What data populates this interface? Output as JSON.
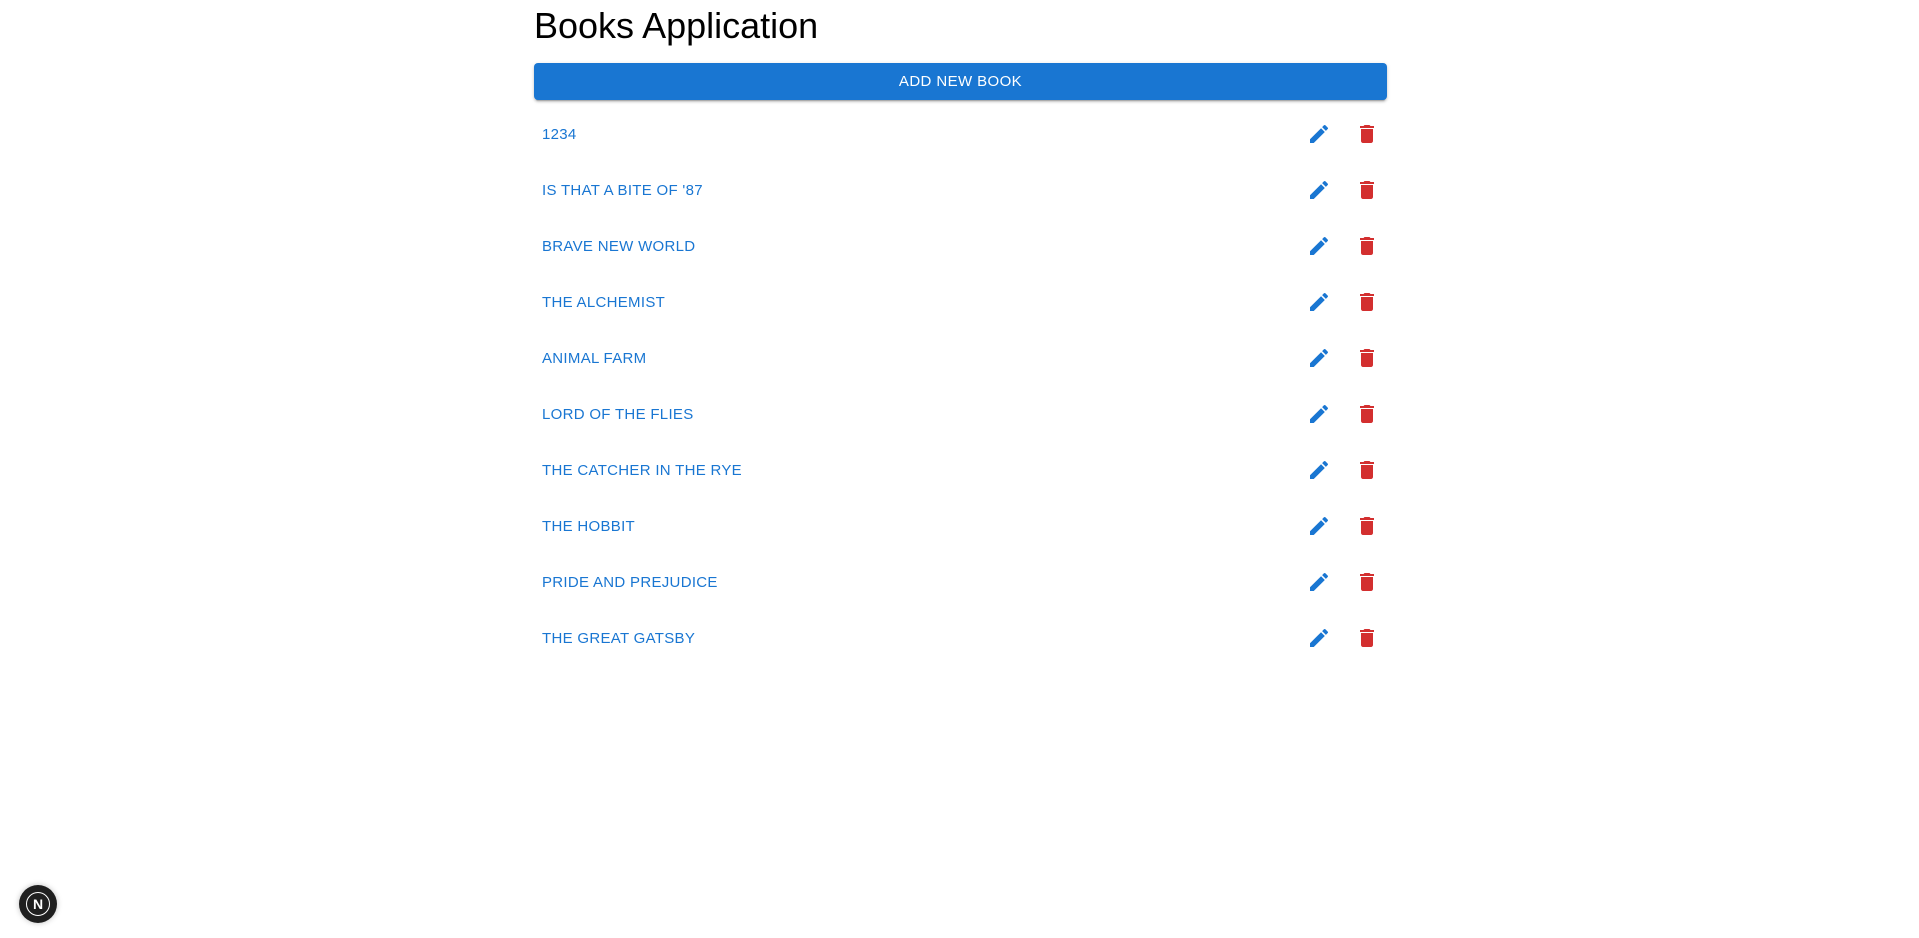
{
  "app": {
    "title": "Books Application",
    "add_button_label": "ADD NEW BOOK"
  },
  "books": [
    {
      "title": "1234"
    },
    {
      "title": "IS THAT A BITE OF '87"
    },
    {
      "title": "BRAVE NEW WORLD"
    },
    {
      "title": "THE ALCHEMIST"
    },
    {
      "title": "ANIMAL FARM"
    },
    {
      "title": "LORD OF THE FLIES"
    },
    {
      "title": "THE CATCHER IN THE RYE"
    },
    {
      "title": "THE HOBBIT"
    },
    {
      "title": "PRIDE AND PREJUDICE"
    },
    {
      "title": "THE GREAT GATSBY"
    }
  ],
  "icons": {
    "edit": "pencil-icon",
    "delete": "trash-icon"
  },
  "colors": {
    "primary": "#1976d2",
    "danger": "#d32f2f"
  },
  "dev_badge": {
    "label": "N"
  }
}
